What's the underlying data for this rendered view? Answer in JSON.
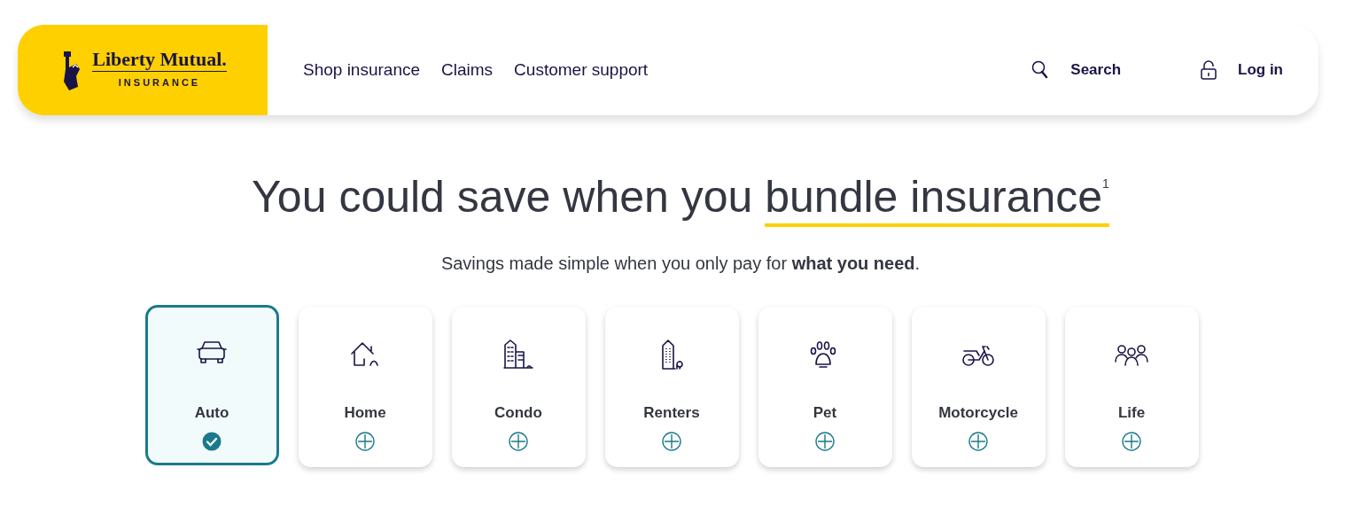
{
  "header": {
    "logo": {
      "name": "Liberty Mutual.",
      "tagline": "INSURANCE"
    },
    "nav": [
      "Shop insurance",
      "Claims",
      "Customer support"
    ],
    "search": "Search",
    "login": "Log in"
  },
  "hero": {
    "heading_lead": "You could save when you ",
    "heading_highlight": "bundle insurance$^{1}$",
    "subtitle": "Savings made simple when you only pay for **what you need**."
  },
  "products": [
    {
      "label": "Auto",
      "selected": true
    },
    {
      "label": "Home",
      "selected": false
    },
    {
      "label": "Condo",
      "selected": false
    },
    {
      "label": "Renters",
      "selected": false
    },
    {
      "label": "Pet",
      "selected": false
    },
    {
      "label": "Motorcycle",
      "selected": false
    },
    {
      "label": "Life",
      "selected": false
    }
  ]
}
